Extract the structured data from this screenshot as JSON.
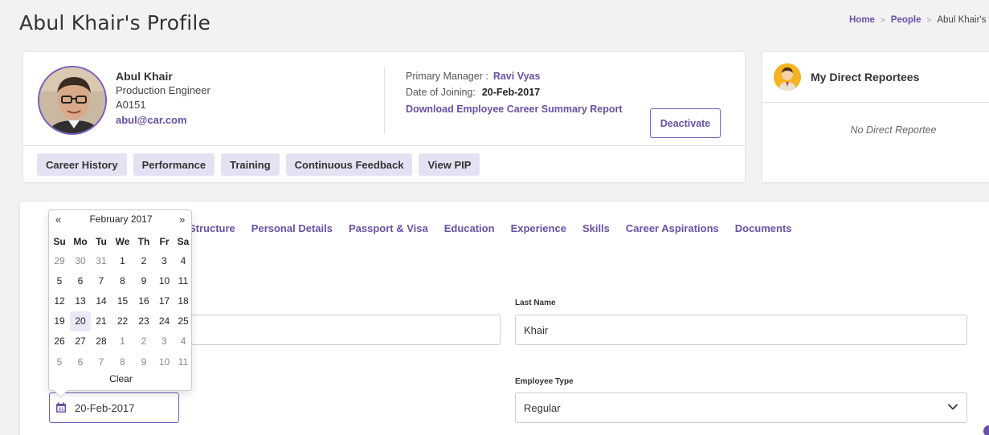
{
  "page": {
    "title": "Abul Khair's Profile",
    "breadcrumb": [
      "Home",
      "People",
      "Abul Khair's P"
    ]
  },
  "profile": {
    "name": "Abul Khair",
    "designation": "Production Engineer",
    "emp_id": "A0151",
    "email": "abul@car.com",
    "manager_label": "Primary Manager :",
    "manager_value": "Ravi Vyas",
    "doj_label": "Date of Joining:",
    "doj_value": "20-Feb-2017",
    "download_link": "Download Employee Career Summary Report",
    "deactivate": "Deactivate",
    "tabs": [
      "Career History",
      "Performance",
      "Training",
      "Continuous Feedback",
      "View PIP"
    ]
  },
  "reportees": {
    "title": "My Direct Reportees",
    "empty": "No Direct Reportee"
  },
  "main": {
    "sub_tabs": [
      "Structure",
      "Personal Details",
      "Passport & Visa",
      "Education",
      "Experience",
      "Skills",
      "Career Aspirations",
      "Documents"
    ],
    "last_name_label": "Last Name",
    "last_name_value": "Khair",
    "employee_type_label": "Employee Type",
    "employee_type_value": "Regular",
    "date_value": "20-Feb-2017"
  },
  "datepicker": {
    "prev": "«",
    "next": "»",
    "title": "February 2017",
    "dow": [
      "Su",
      "Mo",
      "Tu",
      "We",
      "Th",
      "Fr",
      "Sa"
    ],
    "weeks": [
      [
        "29",
        "30",
        "31",
        "1",
        "2",
        "3",
        "4"
      ],
      [
        "5",
        "6",
        "7",
        "8",
        "9",
        "10",
        "11"
      ],
      [
        "12",
        "13",
        "14",
        "15",
        "16",
        "17",
        "18"
      ],
      [
        "19",
        "20",
        "21",
        "22",
        "23",
        "24",
        "25"
      ],
      [
        "26",
        "27",
        "28",
        "1",
        "2",
        "3",
        "4"
      ],
      [
        "5",
        "6",
        "7",
        "8",
        "9",
        "10",
        "11"
      ]
    ],
    "selected": "20",
    "clear": "Clear"
  },
  "colors": {
    "accent": "#6b4fa8",
    "pill_bg": "#e6e1f2",
    "selected_bg": "#ede8f7"
  }
}
